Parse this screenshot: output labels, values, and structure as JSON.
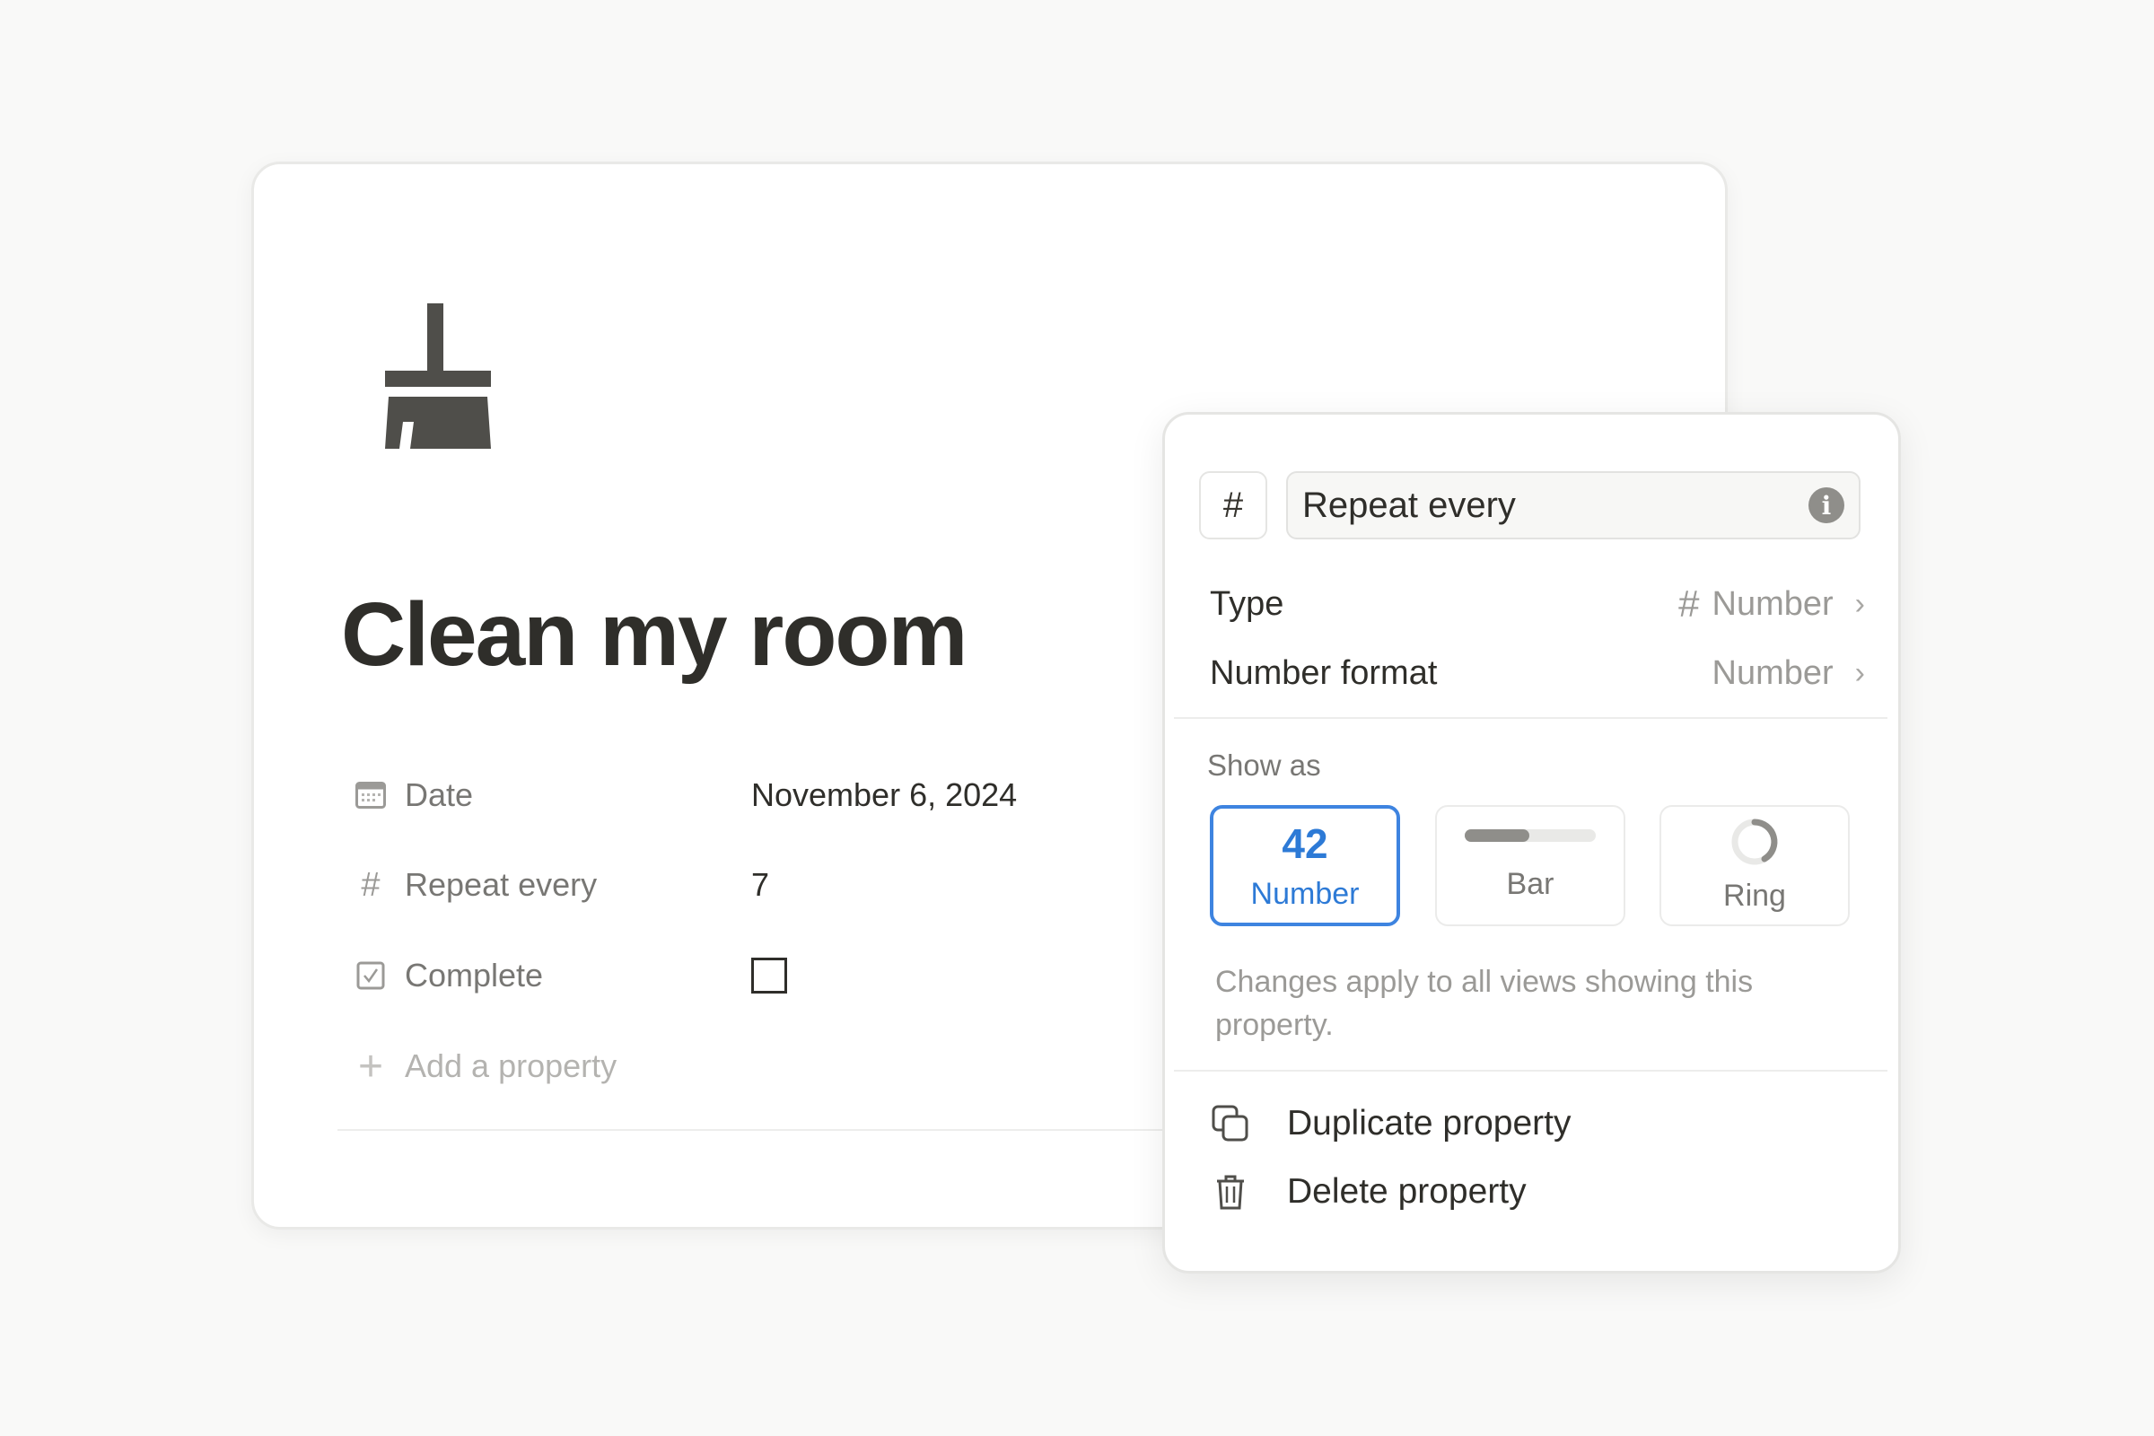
{
  "page": {
    "icon": "broom-icon",
    "title": "Clean my room",
    "properties": [
      {
        "icon": "calendar-icon",
        "label": "Date",
        "value": "November 6, 2024"
      },
      {
        "icon": "hash-icon",
        "label": "Repeat every",
        "value": "7"
      },
      {
        "icon": "checkbox-icon",
        "label": "Complete",
        "value": "",
        "checked": false
      }
    ],
    "add_property": "Add a property"
  },
  "popup": {
    "type_icon": "#",
    "name_value": "Repeat every",
    "type_label": "Type",
    "type_value": "Number",
    "type_icon_glyph": "#",
    "format_label": "Number format",
    "format_value": "Number",
    "show_as_label": "Show as",
    "options": [
      {
        "preview": "42",
        "label": "Number",
        "selected": true
      },
      {
        "label": "Bar",
        "selected": false
      },
      {
        "label": "Ring",
        "selected": false
      }
    ],
    "help": "Changes apply to all views showing this property.",
    "duplicate": "Duplicate property",
    "delete": "Delete property",
    "accent": "#3e84e0"
  }
}
